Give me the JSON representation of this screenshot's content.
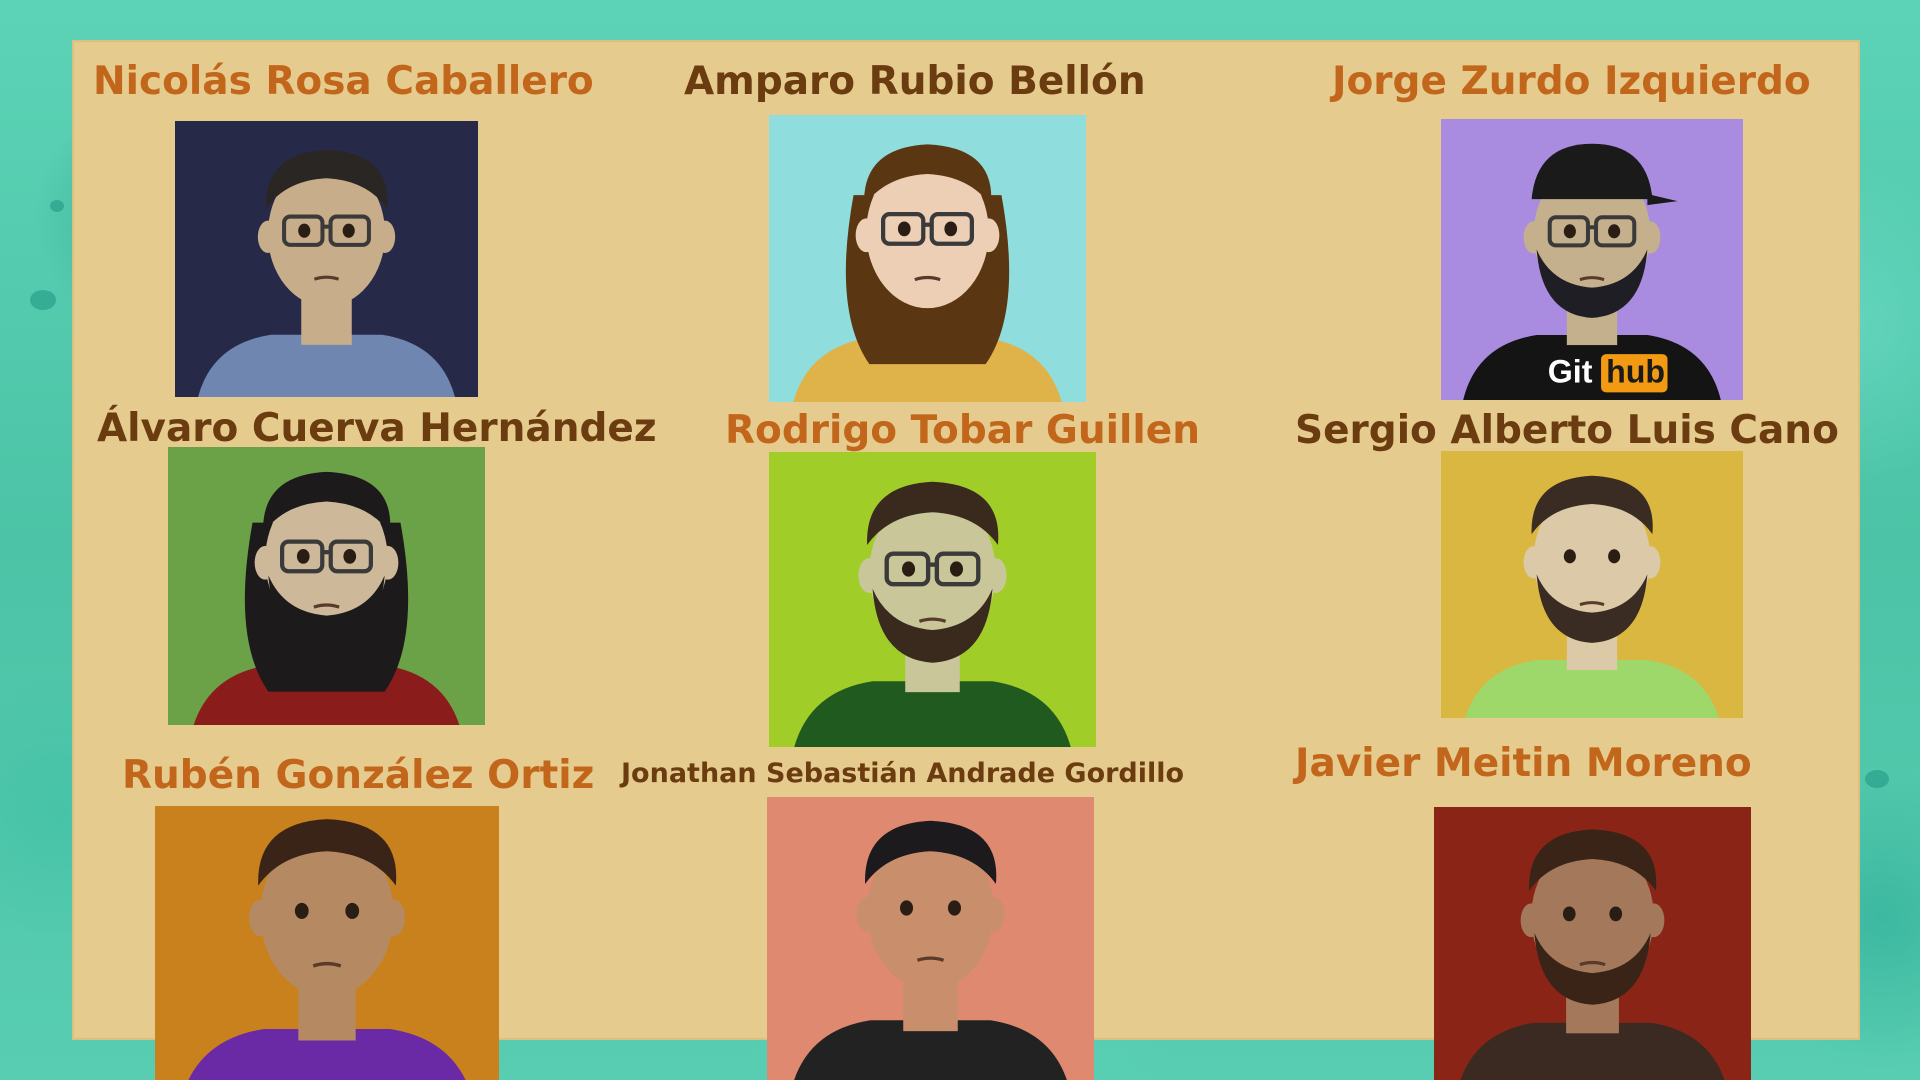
{
  "members": [
    {
      "name": "Nicolás Rosa Caballero",
      "bg": "#262a48",
      "shirt": "#6f86b0"
    },
    {
      "name": "Amparo Rubio Bellón",
      "bg": "#8fdddc",
      "shirt": "#e0b24a"
    },
    {
      "name": "Jorge Zurdo Izquierdo",
      "bg": "#a98ce0",
      "shirt": "#141414"
    },
    {
      "name": "Álvaro Cuerva Hernández",
      "bg": "#6ba247",
      "shirt": "#8a1c1c"
    },
    {
      "name": "Rodrigo Tobar Guillen",
      "bg": "#a1cd28",
      "shirt": "#215a1f"
    },
    {
      "name": "Sergio Alberto Luis Cano",
      "bg": "#dab740",
      "shirt": "#9ed86a"
    },
    {
      "name": "Rubén González Ortiz",
      "bg": "#c8811c",
      "shirt": "#6b2aa5"
    },
    {
      "name": "Jonathan Sebastián Andrade Gordillo",
      "bg": "#df8a70",
      "shirt": "#222222"
    },
    {
      "name": "Javier Meitin Moreno",
      "bg": "#8a2417",
      "shirt": "#3a2a22"
    }
  ],
  "shirt_logo": {
    "left": "Git",
    "right": "hub"
  }
}
